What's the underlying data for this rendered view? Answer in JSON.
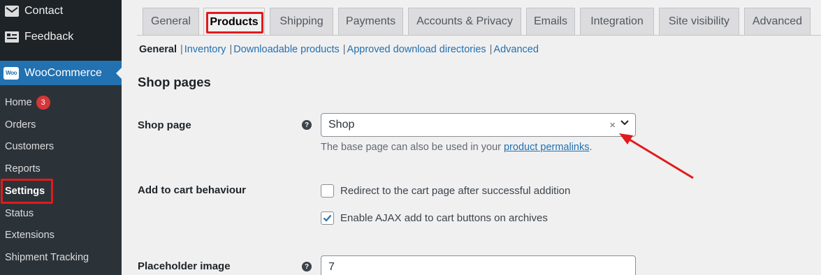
{
  "sidebar": {
    "top_items": [
      {
        "label": "Contact",
        "icon": "envelope-icon"
      },
      {
        "label": "Feedback",
        "icon": "feedback-icon"
      }
    ],
    "woocommerce": {
      "label": "WooCommerce",
      "logo_text": "Woo"
    },
    "submenu": [
      {
        "label": "Home",
        "badge": "3"
      },
      {
        "label": "Orders"
      },
      {
        "label": "Customers"
      },
      {
        "label": "Reports"
      },
      {
        "label": "Settings",
        "current": true
      },
      {
        "label": "Status"
      },
      {
        "label": "Extensions"
      },
      {
        "label": "Shipment Tracking"
      }
    ]
  },
  "tabs": [
    "General",
    "Products",
    "Shipping",
    "Payments",
    "Accounts & Privacy",
    "Emails",
    "Integration",
    "Site visibility",
    "Advanced"
  ],
  "active_tab": "Products",
  "subsections": [
    "General",
    "Inventory",
    "Downloadable products",
    "Approved download directories",
    "Advanced"
  ],
  "current_subsection": "General",
  "section_title": "Shop pages",
  "shop_page": {
    "label": "Shop page",
    "help": "?",
    "value": "Shop",
    "clear": "×",
    "desc_prefix": "The base page can also be used in your ",
    "desc_link": "product permalinks",
    "desc_suffix": "."
  },
  "add_to_cart": {
    "label": "Add to cart behaviour",
    "options": [
      {
        "label": "Redirect to the cart page after successful addition",
        "checked": false
      },
      {
        "label": "Enable AJAX add to cart buttons on archives",
        "checked": true
      }
    ]
  },
  "placeholder_image": {
    "label": "Placeholder image",
    "help": "?",
    "value": "7"
  },
  "colors": {
    "highlight": "#e01b1b",
    "accent": "#2271b1",
    "sidebar_bg": "#1d2327"
  }
}
